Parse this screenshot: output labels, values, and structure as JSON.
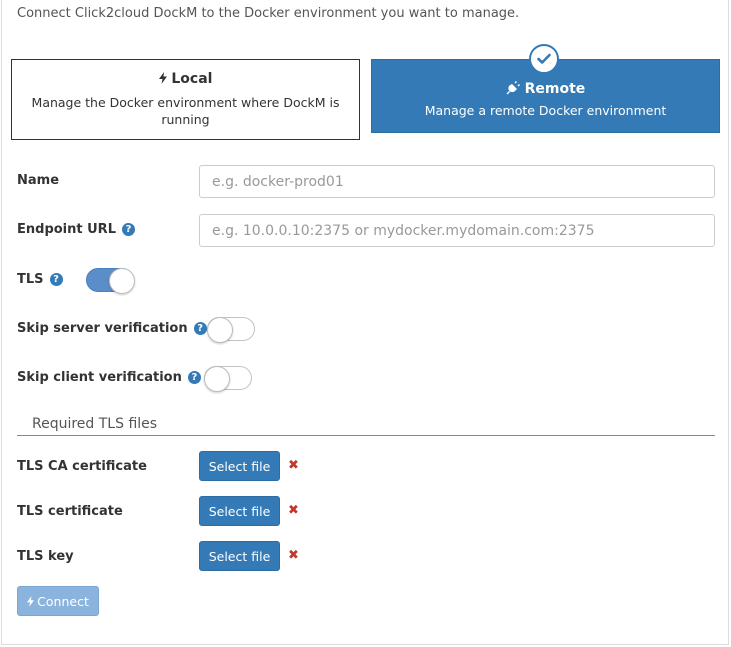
{
  "intro_text": "Connect Click2cloud DockM to the Docker environment you want to manage.",
  "options": {
    "local": {
      "icon": "bolt-icon",
      "title": "Local",
      "description": "Manage the Docker environment where DockM is running"
    },
    "remote": {
      "icon": "plug-icon",
      "title": "Remote",
      "description": "Manage a remote Docker environment",
      "selected": true
    }
  },
  "form": {
    "name": {
      "label": "Name",
      "placeholder": "e.g. docker-prod01",
      "value": ""
    },
    "endpoint_url": {
      "label": "Endpoint URL",
      "placeholder": "e.g. 10.0.0.10:2375 or mydocker.mydomain.com:2375",
      "value": ""
    },
    "tls": {
      "label": "TLS",
      "enabled": true
    },
    "skip_server_verification": {
      "label": "Skip server verification",
      "enabled": false
    },
    "skip_client_verification": {
      "label": "Skip client verification",
      "enabled": false
    }
  },
  "tls_files": {
    "section_title": "Required TLS files",
    "select_label": "Select file",
    "remove_glyph": "✖",
    "ca_cert": {
      "label": "TLS CA certificate"
    },
    "cert": {
      "label": "TLS certificate"
    },
    "key": {
      "label": "TLS key"
    }
  },
  "connect_button": {
    "label": "Connect",
    "icon": "bolt-icon"
  },
  "colors": {
    "primary": "#337ab7",
    "primary_disabled": "#8ab4dd",
    "danger": "#c0392b",
    "switch_on": "#5b8ec9"
  },
  "help_glyph": "?"
}
